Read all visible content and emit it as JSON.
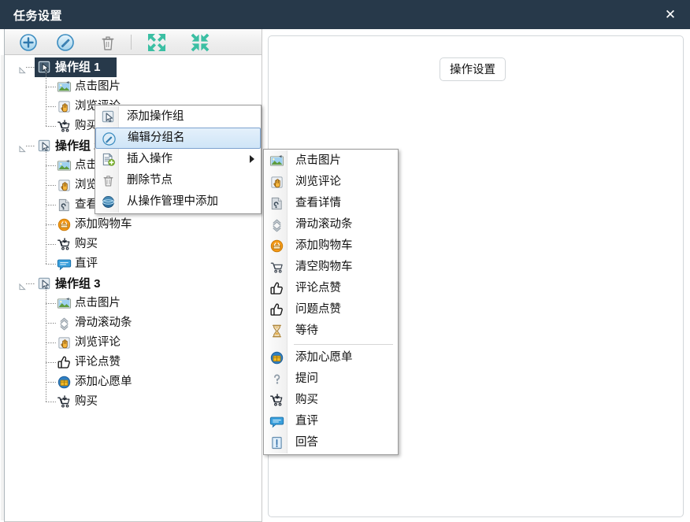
{
  "window": {
    "title": "任务设置",
    "close_label": "✕",
    "close_icon": "close-icon"
  },
  "colors": {
    "titlebar_bg": "#27394a",
    "selection_bg": "#27394a",
    "menu_highlight_bg": "#cfe5f7",
    "menu_highlight_border": "#7da2ce",
    "accent_blue": "#4d9bd5",
    "accent_green": "#3bbfa3",
    "panel_border": "#d2d6d9"
  },
  "toolbar": {
    "buttons": [
      {
        "name": "add-button",
        "icon": "plus-circle-icon",
        "tooltip": "添加"
      },
      {
        "name": "edit-button",
        "icon": "pencil-circle-icon",
        "tooltip": "编辑"
      },
      {
        "name": "delete-button",
        "icon": "trash-icon",
        "tooltip": "删除"
      },
      {
        "name": "expand-all-button",
        "icon": "expand-arrows-icon",
        "tooltip": "展开"
      },
      {
        "name": "collapse-all-button",
        "icon": "collapse-arrows-icon",
        "tooltip": "折叠"
      }
    ]
  },
  "tree": {
    "groups": [
      {
        "label": "操作组 1",
        "icon": "cursor-group-icon",
        "selected": true,
        "expanded": true,
        "children": [
          {
            "label": "点击图片",
            "icon": "image-icon"
          },
          {
            "label": "浏览评论",
            "icon": "hand-click-icon"
          },
          {
            "label": "购买",
            "icon": "cart-down-icon"
          }
        ]
      },
      {
        "label": "操作组 2",
        "icon": "cursor-group-icon",
        "selected": false,
        "expanded": true,
        "children": [
          {
            "label": "点击图片",
            "icon": "image-icon"
          },
          {
            "label": "浏览评论",
            "icon": "hand-click-icon"
          },
          {
            "label": "查看详情",
            "icon": "details-icon"
          },
          {
            "label": "添加购物车",
            "icon": "cart-add-icon"
          },
          {
            "label": "购买",
            "icon": "cart-down-icon"
          },
          {
            "label": "直评",
            "icon": "comment-icon"
          }
        ]
      },
      {
        "label": "操作组 3",
        "icon": "cursor-group-icon",
        "selected": false,
        "expanded": true,
        "children": [
          {
            "label": "点击图片",
            "icon": "image-icon"
          },
          {
            "label": "滑动滚动条",
            "icon": "scroll-icon"
          },
          {
            "label": "浏览评论",
            "icon": "hand-click-icon"
          },
          {
            "label": "评论点赞",
            "icon": "thumb-up-icon"
          },
          {
            "label": "添加心愿单",
            "icon": "wishlist-icon"
          },
          {
            "label": "购买",
            "icon": "cart-down-icon"
          }
        ]
      }
    ]
  },
  "right_panel": {
    "legend": "操作设置"
  },
  "context_menu": {
    "items": [
      {
        "label": "添加操作组",
        "icon": "cursor-group-icon",
        "highlighted": false,
        "submenu": false
      },
      {
        "label": "编辑分组名",
        "icon": "pencil-circle-icon",
        "highlighted": true,
        "submenu": false
      },
      {
        "label": "插入操作",
        "icon": "insert-doc-icon",
        "highlighted": false,
        "submenu": true
      },
      {
        "label": "删除节点",
        "icon": "trash-icon",
        "highlighted": false,
        "submenu": false
      },
      {
        "label": "从操作管理中添加",
        "icon": "globe-icon",
        "highlighted": false,
        "submenu": false
      }
    ]
  },
  "submenu": {
    "items": [
      {
        "label": "点击图片",
        "icon": "image-icon",
        "separator_after": false
      },
      {
        "label": "浏览评论",
        "icon": "hand-click-icon",
        "separator_after": false
      },
      {
        "label": "查看详情",
        "icon": "details-icon",
        "separator_after": false
      },
      {
        "label": "滑动滚动条",
        "icon": "scroll-icon",
        "separator_after": false
      },
      {
        "label": "添加购物车",
        "icon": "cart-add-icon",
        "separator_after": false
      },
      {
        "label": "清空购物车",
        "icon": "cart-empty-icon",
        "separator_after": false
      },
      {
        "label": "评论点赞",
        "icon": "thumb-up-icon",
        "separator_after": false
      },
      {
        "label": "问题点赞",
        "icon": "thumb-up-icon",
        "separator_after": false
      },
      {
        "label": "等待",
        "icon": "hourglass-icon",
        "separator_after": true
      },
      {
        "label": "添加心愿单",
        "icon": "wishlist-icon",
        "separator_after": false
      },
      {
        "label": "提问",
        "icon": "question-icon",
        "separator_after": false
      },
      {
        "label": "购买",
        "icon": "cart-down-icon",
        "separator_after": false
      },
      {
        "label": "直评",
        "icon": "comment-icon",
        "separator_after": false
      },
      {
        "label": "回答",
        "icon": "answer-icon",
        "separator_after": false
      }
    ]
  }
}
